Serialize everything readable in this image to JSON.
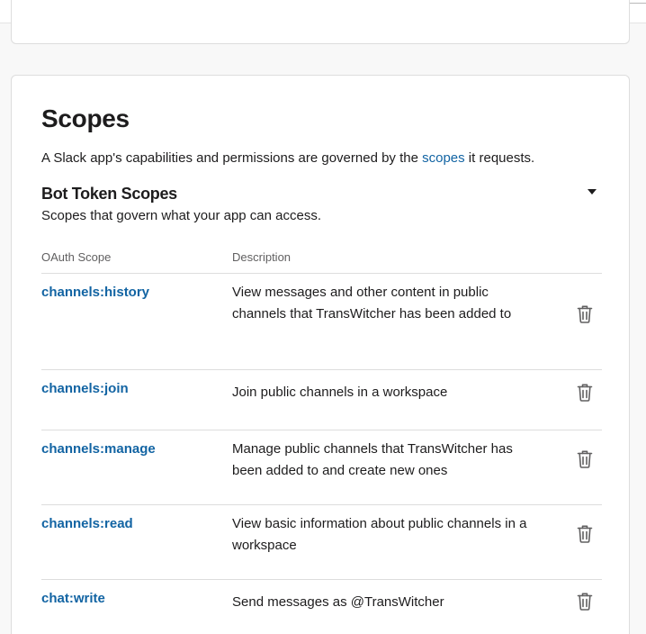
{
  "section": {
    "title": "Scopes",
    "intro_before": "A Slack app's capabilities and permissions are governed by the ",
    "intro_link": "scopes",
    "intro_after": " it requests."
  },
  "bot_scopes": {
    "title": "Bot Token Scopes",
    "description": "Scopes that govern what your app can access.",
    "col_scope": "OAuth Scope",
    "col_description": "Description",
    "rows": [
      {
        "scope": "channels:history",
        "description": "View messages and other content in public channels that TransWitcher has been added to"
      },
      {
        "scope": "channels:join",
        "description": "Join public channels in a workspace"
      },
      {
        "scope": "channels:manage",
        "description": "Manage public channels that TransWitcher has been added to and create new ones"
      },
      {
        "scope": "channels:read",
        "description": "View basic information about public channels in a workspace"
      },
      {
        "scope": "chat:write",
        "description": "Send messages as @TransWitcher"
      }
    ]
  },
  "icons": {
    "collapse": "caret-down-icon",
    "remove": "trash-icon"
  },
  "colors": {
    "link": "#1264a3",
    "text": "#1d1c1d",
    "muted": "#616061",
    "divider": "#dddddd",
    "background": "#f8f8f8"
  }
}
